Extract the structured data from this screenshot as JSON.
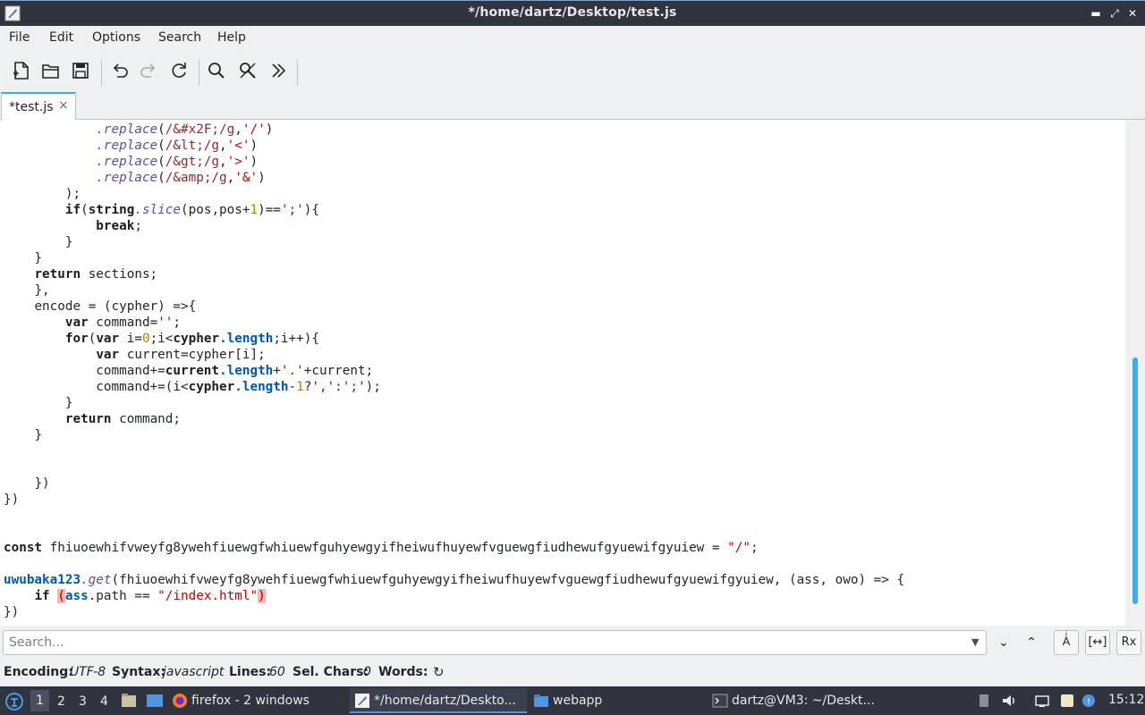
{
  "window": {
    "title": "*/home/dartz/Desktop/test.js"
  },
  "menu": [
    "File",
    "Edit",
    "Options",
    "Search",
    "Help"
  ],
  "toolbar": {
    "icons": [
      "new-file-icon",
      "open-file-icon",
      "save-icon",
      "undo-icon",
      "redo-icon",
      "reload-icon",
      "find-icon",
      "replace-icon",
      "more-icon"
    ]
  },
  "tab": {
    "label": "*test.js",
    "close": "×"
  },
  "search": {
    "placeholder": "Search...",
    "value": ""
  },
  "status": {
    "encoding_label": "Encoding:",
    "encoding": "UTF-8",
    "syntax_label": "Syntax:",
    "syntax": "javascript",
    "lines_label": "Lines:",
    "lines": "60",
    "selchars_label": "Sel. Chars:",
    "selchars": "0",
    "words_label": "Words:"
  },
  "taskbar": {
    "workspaces": [
      "1",
      "2",
      "3",
      "4"
    ],
    "tasks": [
      {
        "label": "firefox - 2 windows"
      },
      {
        "label": "*/home/dartz/Deskto..."
      },
      {
        "label": "webapp"
      },
      {
        "label": "dartz@VM3: ~/Deskt..."
      }
    ],
    "clock": "15:12"
  },
  "code_lines": [
    [
      [
        "",
        "            "
      ],
      [
        "fn",
        ".replace"
      ],
      [
        "",
        "("
      ],
      [
        "rx",
        "/&#x2F;/g"
      ],
      [
        "",
        ","
      ],
      [
        "st",
        "'/'"
      ],
      [
        "",
        ")"
      ]
    ],
    [
      [
        "",
        "            "
      ],
      [
        "fn",
        ".replace"
      ],
      [
        "",
        "("
      ],
      [
        "rx",
        "/&lt;/g"
      ],
      [
        "",
        ","
      ],
      [
        "st",
        "'<'"
      ],
      [
        "",
        ")"
      ]
    ],
    [
      [
        "",
        "            "
      ],
      [
        "fn",
        ".replace"
      ],
      [
        "",
        "("
      ],
      [
        "rx",
        "/&gt;/g"
      ],
      [
        "",
        ","
      ],
      [
        "st",
        "'>'"
      ],
      [
        "",
        ")"
      ]
    ],
    [
      [
        "",
        "            "
      ],
      [
        "fn",
        ".replace"
      ],
      [
        "",
        "("
      ],
      [
        "rx",
        "/&amp;/g"
      ],
      [
        "",
        ","
      ],
      [
        "st",
        "'&'"
      ],
      [
        "",
        ")"
      ]
    ],
    [
      [
        "",
        "        );"
      ]
    ],
    [
      [
        "",
        "        "
      ],
      [
        "kw",
        "if"
      ],
      [
        "",
        "("
      ],
      [
        "kw",
        "string"
      ],
      [
        "fn",
        ".slice"
      ],
      [
        "",
        "(pos,pos+"
      ],
      [
        "nm",
        "1"
      ],
      [
        "",
        ")=="
      ],
      [
        "st",
        "';'"
      ],
      [
        "",
        "){"
      ]
    ],
    [
      [
        "",
        "            "
      ],
      [
        "kw",
        "break"
      ],
      [
        "",
        ";"
      ]
    ],
    [
      [
        "",
        "        }"
      ]
    ],
    [
      [
        "",
        "    }"
      ]
    ],
    [
      [
        "",
        "    "
      ],
      [
        "kw",
        "return"
      ],
      [
        "",
        " sections;"
      ]
    ],
    [
      [
        "",
        "},"
      ]
    ],
    [
      [
        "",
        "encode = (cypher) =>{"
      ]
    ],
    [
      [
        "",
        "    "
      ],
      [
        "kw",
        "var"
      ],
      [
        "",
        " command="
      ],
      [
        "st",
        "''"
      ],
      [
        "",
        ";"
      ]
    ],
    [
      [
        "",
        "    "
      ],
      [
        "kw",
        "for"
      ],
      [
        "",
        "("
      ],
      [
        "kw",
        "var"
      ],
      [
        "",
        " i="
      ],
      [
        "nm",
        "0"
      ],
      [
        "",
        ";i<"
      ],
      [
        "kw",
        "cypher"
      ],
      [
        "pr",
        ".length"
      ],
      [
        "",
        ";i++){"
      ]
    ],
    [
      [
        "",
        "        "
      ],
      [
        "kw",
        "var"
      ],
      [
        "",
        " current=cypher[i];"
      ]
    ],
    [
      [
        "",
        "        command+="
      ],
      [
        "kw",
        "current"
      ],
      [
        "pr",
        ".length"
      ],
      [
        "",
        "+"
      ],
      [
        "st",
        "'.'"
      ],
      [
        "",
        "+current;"
      ]
    ],
    [
      [
        "",
        "        command+=(i<"
      ],
      [
        "kw",
        "cypher"
      ],
      [
        "pr",
        ".length"
      ],
      [
        "",
        "-"
      ],
      [
        "nm",
        "1"
      ],
      [
        "",
        "?"
      ],
      [
        "st",
        "','"
      ],
      [
        "",
        ":"
      ],
      [
        "st",
        "';'"
      ],
      [
        "",
        ");"
      ]
    ],
    [
      [
        "",
        "    }"
      ]
    ],
    [
      [
        "",
        "    "
      ],
      [
        "kw",
        "return"
      ],
      [
        "",
        " command;"
      ]
    ],
    [
      [
        "",
        "}"
      ]
    ],
    [
      [
        "",
        ""
      ]
    ],
    [
      [
        "",
        ""
      ]
    ],
    [
      [
        "",
        "})"
      ]
    ],
    [
      [
        "",
        "})"
      ]
    ],
    [
      [
        "",
        ""
      ]
    ],
    [
      [
        "",
        ""
      ]
    ],
    [
      [
        "kw",
        "const"
      ],
      [
        "",
        " fhiuoewhifvweyfg8ywehfiuewgfwhiuewfguhyewgyifheiwufhuyewfvguewgfiudhewufgyuewifgyuiew = "
      ],
      [
        "st2",
        "\"/\""
      ],
      [
        "",
        ";"
      ]
    ],
    [
      [
        "",
        ""
      ]
    ],
    [
      [
        "pr",
        "uwubaka123"
      ],
      [
        "fn",
        ".get"
      ],
      [
        "",
        "(fhiuoewhifvweyfg8ywehfiuewgfwhiuewfguhyewgyifheiwufhuyewfvguewgfiudhewufgyuewifgyuiew, (ass, owo) => {"
      ]
    ],
    [
      [
        "",
        "    "
      ],
      [
        "kw",
        "if"
      ],
      [
        "",
        " "
      ],
      [
        "bm",
        "("
      ],
      [
        "pr",
        "ass"
      ],
      [
        "",
        ".path == "
      ],
      [
        "st2",
        "\"/index.html\""
      ],
      [
        "bm",
        ")"
      ]
    ],
    [
      [
        "",
        "})"
      ]
    ]
  ],
  "code_indent": [
    0,
    0,
    0,
    0,
    0,
    0,
    0,
    0,
    0,
    0,
    4,
    4,
    4,
    4,
    4,
    4,
    4,
    4,
    4,
    4,
    0,
    0,
    4,
    0,
    0,
    0,
    0,
    0,
    0,
    0,
    0
  ]
}
